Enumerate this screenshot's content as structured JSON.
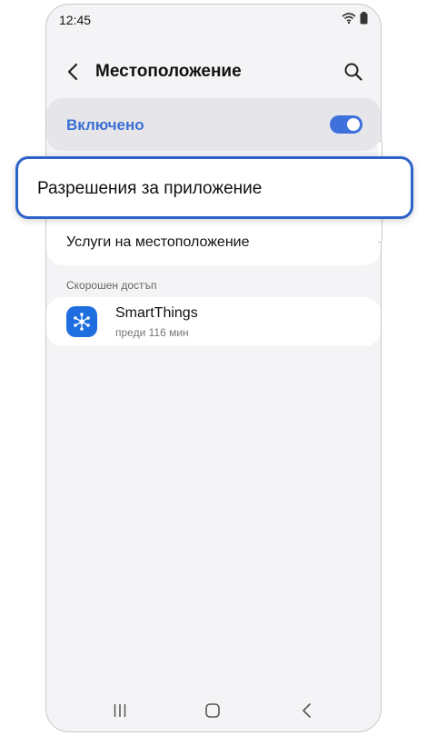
{
  "status_bar": {
    "time": "12:45"
  },
  "header": {
    "title": "Местоположение"
  },
  "toggle": {
    "label": "Включено",
    "on": true
  },
  "settings": {
    "app_permissions": "Разрешения за приложение",
    "location_services": "Услуги на местоположение"
  },
  "recent": {
    "header": "Скорошен достъп",
    "items": [
      {
        "name": "SmartThings",
        "time": "преди 116 мин"
      }
    ]
  },
  "colors": {
    "accent": "#3e71dc",
    "highlight_border": "#2d62c9"
  },
  "icons": [
    "back-arrow-icon",
    "search-icon",
    "wifi-icon",
    "battery-icon",
    "smartthings-icon"
  ]
}
